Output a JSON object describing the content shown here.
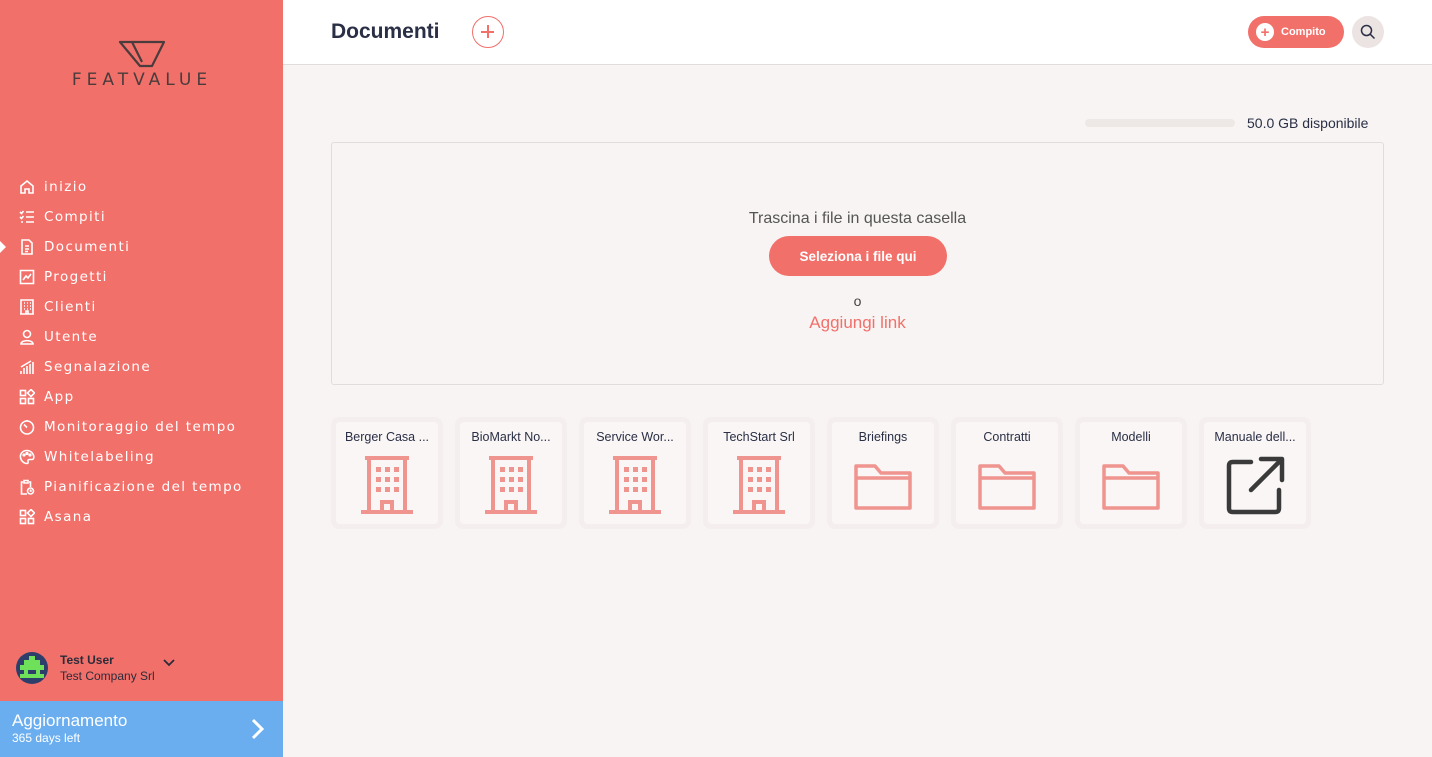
{
  "sidebar": {
    "brand": "FEATVALUE",
    "accent": "#f2706a",
    "items": [
      {
        "label": "inizio",
        "icon": "home-icon"
      },
      {
        "label": "Compiti",
        "icon": "task-list-icon"
      },
      {
        "label": "Documenti",
        "icon": "document-icon",
        "active": true
      },
      {
        "label": "Progetti",
        "icon": "chart-board-icon"
      },
      {
        "label": "Clienti",
        "icon": "building-icon"
      },
      {
        "label": "Utente",
        "icon": "user-icon"
      },
      {
        "label": "Segnalazione",
        "icon": "bar-chart-icon"
      },
      {
        "label": "App",
        "icon": "apps-icon"
      },
      {
        "label": "Monitoraggio del tempo",
        "icon": "timer-icon"
      },
      {
        "label": "Whitelabeling",
        "icon": "palette-icon"
      },
      {
        "label": "Pianificazione del tempo",
        "icon": "clipboard-clock-icon"
      },
      {
        "label": "Asana",
        "icon": "apps-icon"
      }
    ],
    "user": {
      "name": "Test User",
      "company": "Test Company Srl"
    },
    "upgrade": {
      "title": "Aggiornamento",
      "subtitle": "365 days left",
      "color": "#6aaef0"
    }
  },
  "header": {
    "title": "Documenti",
    "task_button": "Compito"
  },
  "storage": {
    "label": "50.0 GB disponibile",
    "used_fraction": 0
  },
  "dropzone": {
    "drag_text": "Trascina i file in questa casella",
    "select_button": "Seleziona i file qui",
    "or_text": "o",
    "add_link": "Aggiungi link"
  },
  "tiles": [
    {
      "label": "Berger Casa ...",
      "icon": "building-icon"
    },
    {
      "label": "BioMarkt No...",
      "icon": "building-icon"
    },
    {
      "label": "Service Wor...",
      "icon": "building-icon"
    },
    {
      "label": "TechStart Srl",
      "icon": "building-icon"
    },
    {
      "label": "Briefings",
      "icon": "folder-icon"
    },
    {
      "label": "Contratti",
      "icon": "folder-icon"
    },
    {
      "label": "Modelli",
      "icon": "folder-icon"
    },
    {
      "label": "Manuale dell...",
      "icon": "external-link-icon"
    }
  ]
}
